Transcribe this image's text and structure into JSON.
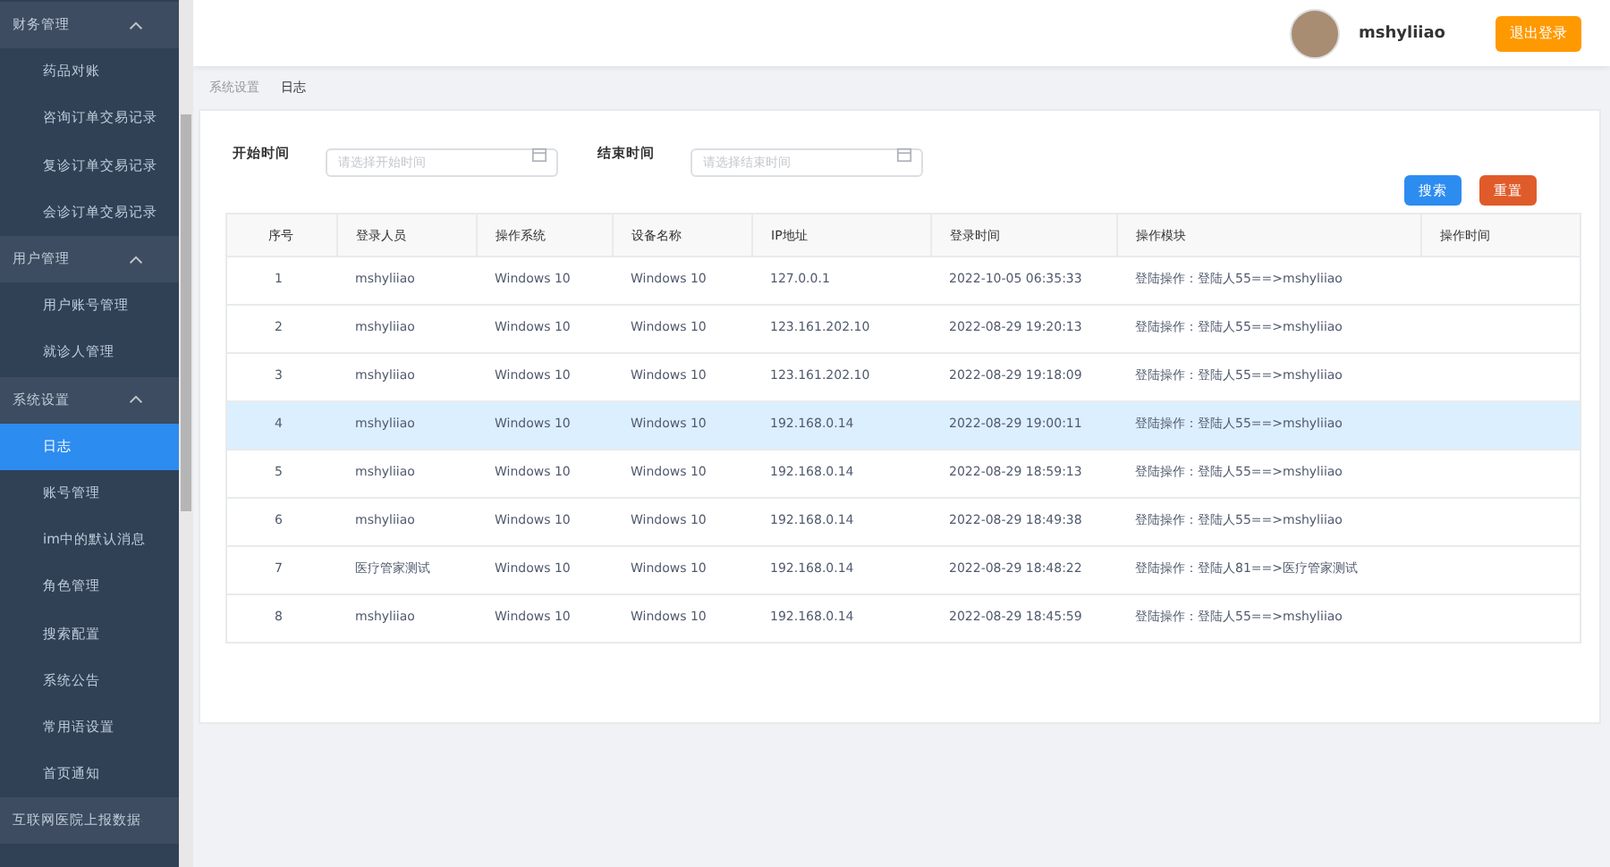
{
  "sidebar": {
    "groups": [
      {
        "label": "财务管理",
        "expanded": true,
        "items": [
          {
            "label": "药品对账",
            "selected": false
          },
          {
            "label": "咨询订单交易记录",
            "selected": false
          },
          {
            "label": "复诊订单交易记录",
            "selected": false
          },
          {
            "label": "会诊订单交易记录",
            "selected": false
          }
        ]
      },
      {
        "label": "用户管理",
        "expanded": true,
        "items": [
          {
            "label": "用户账号管理",
            "selected": false
          },
          {
            "label": "就诊人管理",
            "selected": false
          }
        ]
      },
      {
        "label": "系统设置",
        "expanded": true,
        "items": [
          {
            "label": "日志",
            "selected": true
          },
          {
            "label": "账号管理",
            "selected": false
          },
          {
            "label": "im中的默认消息",
            "selected": false
          },
          {
            "label": "角色管理",
            "selected": false
          },
          {
            "label": "搜索配置",
            "selected": false
          },
          {
            "label": "系统公告",
            "selected": false
          },
          {
            "label": "常用语设置",
            "selected": false
          },
          {
            "label": "首页通知",
            "selected": false
          }
        ]
      },
      {
        "label": "互联网医院上报数据",
        "expanded": true
      }
    ]
  },
  "header": {
    "username": "mshyliiao",
    "logout_button": "退出登录"
  },
  "breadcrumb": [
    "系统设置",
    "日志"
  ],
  "filters": [
    {
      "label": "开始时间",
      "placeholder": "请选择开始时间"
    },
    {
      "label": "结束时间",
      "placeholder": "请选择结束时间"
    }
  ],
  "buttons": {
    "search": "搜索",
    "reset": "重置"
  },
  "table": {
    "columns": [
      "序号",
      "登录人员",
      "操作系统",
      "设备名称",
      "IP地址",
      "登录时间",
      "操作模块",
      "操作时间"
    ],
    "rows": [
      {
        "highlighted": false,
        "cells": [
          "1",
          "mshyliiao",
          "Windows 10",
          "Windows 10",
          "127.0.0.1",
          "2022-10-05 06:35:33",
          "登陆操作：登陆人55==>mshyliiao",
          ""
        ]
      },
      {
        "highlighted": false,
        "cells": [
          "2",
          "mshyliiao",
          "Windows 10",
          "Windows 10",
          "123.161.202.10",
          "2022-08-29 19:20:13",
          "登陆操作：登陆人55==>mshyliiao",
          ""
        ]
      },
      {
        "highlighted": false,
        "cells": [
          "3",
          "mshyliiao",
          "Windows 10",
          "Windows 10",
          "123.161.202.10",
          "2022-08-29 19:18:09",
          "登陆操作：登陆人55==>mshyliiao",
          ""
        ]
      },
      {
        "highlighted": true,
        "cells": [
          "4",
          "mshyliiao",
          "Windows 10",
          "Windows 10",
          "192.168.0.14",
          "2022-08-29 19:00:11",
          "登陆操作：登陆人55==>mshyliiao",
          ""
        ]
      },
      {
        "highlighted": false,
        "cells": [
          "5",
          "mshyliiao",
          "Windows 10",
          "Windows 10",
          "192.168.0.14",
          "2022-08-29 18:59:13",
          "登陆操作：登陆人55==>mshyliiao",
          ""
        ]
      },
      {
        "highlighted": false,
        "cells": [
          "6",
          "mshyliiao",
          "Windows 10",
          "Windows 10",
          "192.168.0.14",
          "2022-08-29 18:49:38",
          "登陆操作：登陆人55==>mshyliiao",
          ""
        ]
      },
      {
        "highlighted": false,
        "cells": [
          "7",
          "医疗管家测试",
          "Windows 10",
          "Windows 10",
          "192.168.0.14",
          "2022-08-29 18:48:22",
          "登陆操作：登陆人81==>医疗管家测试",
          ""
        ]
      },
      {
        "highlighted": false,
        "cells": [
          "8",
          "mshyliiao",
          "Windows 10",
          "Windows 10",
          "192.168.0.14",
          "2022-08-29 18:45:59",
          "登陆操作：登陆人55==>mshyliiao",
          ""
        ]
      }
    ]
  }
}
